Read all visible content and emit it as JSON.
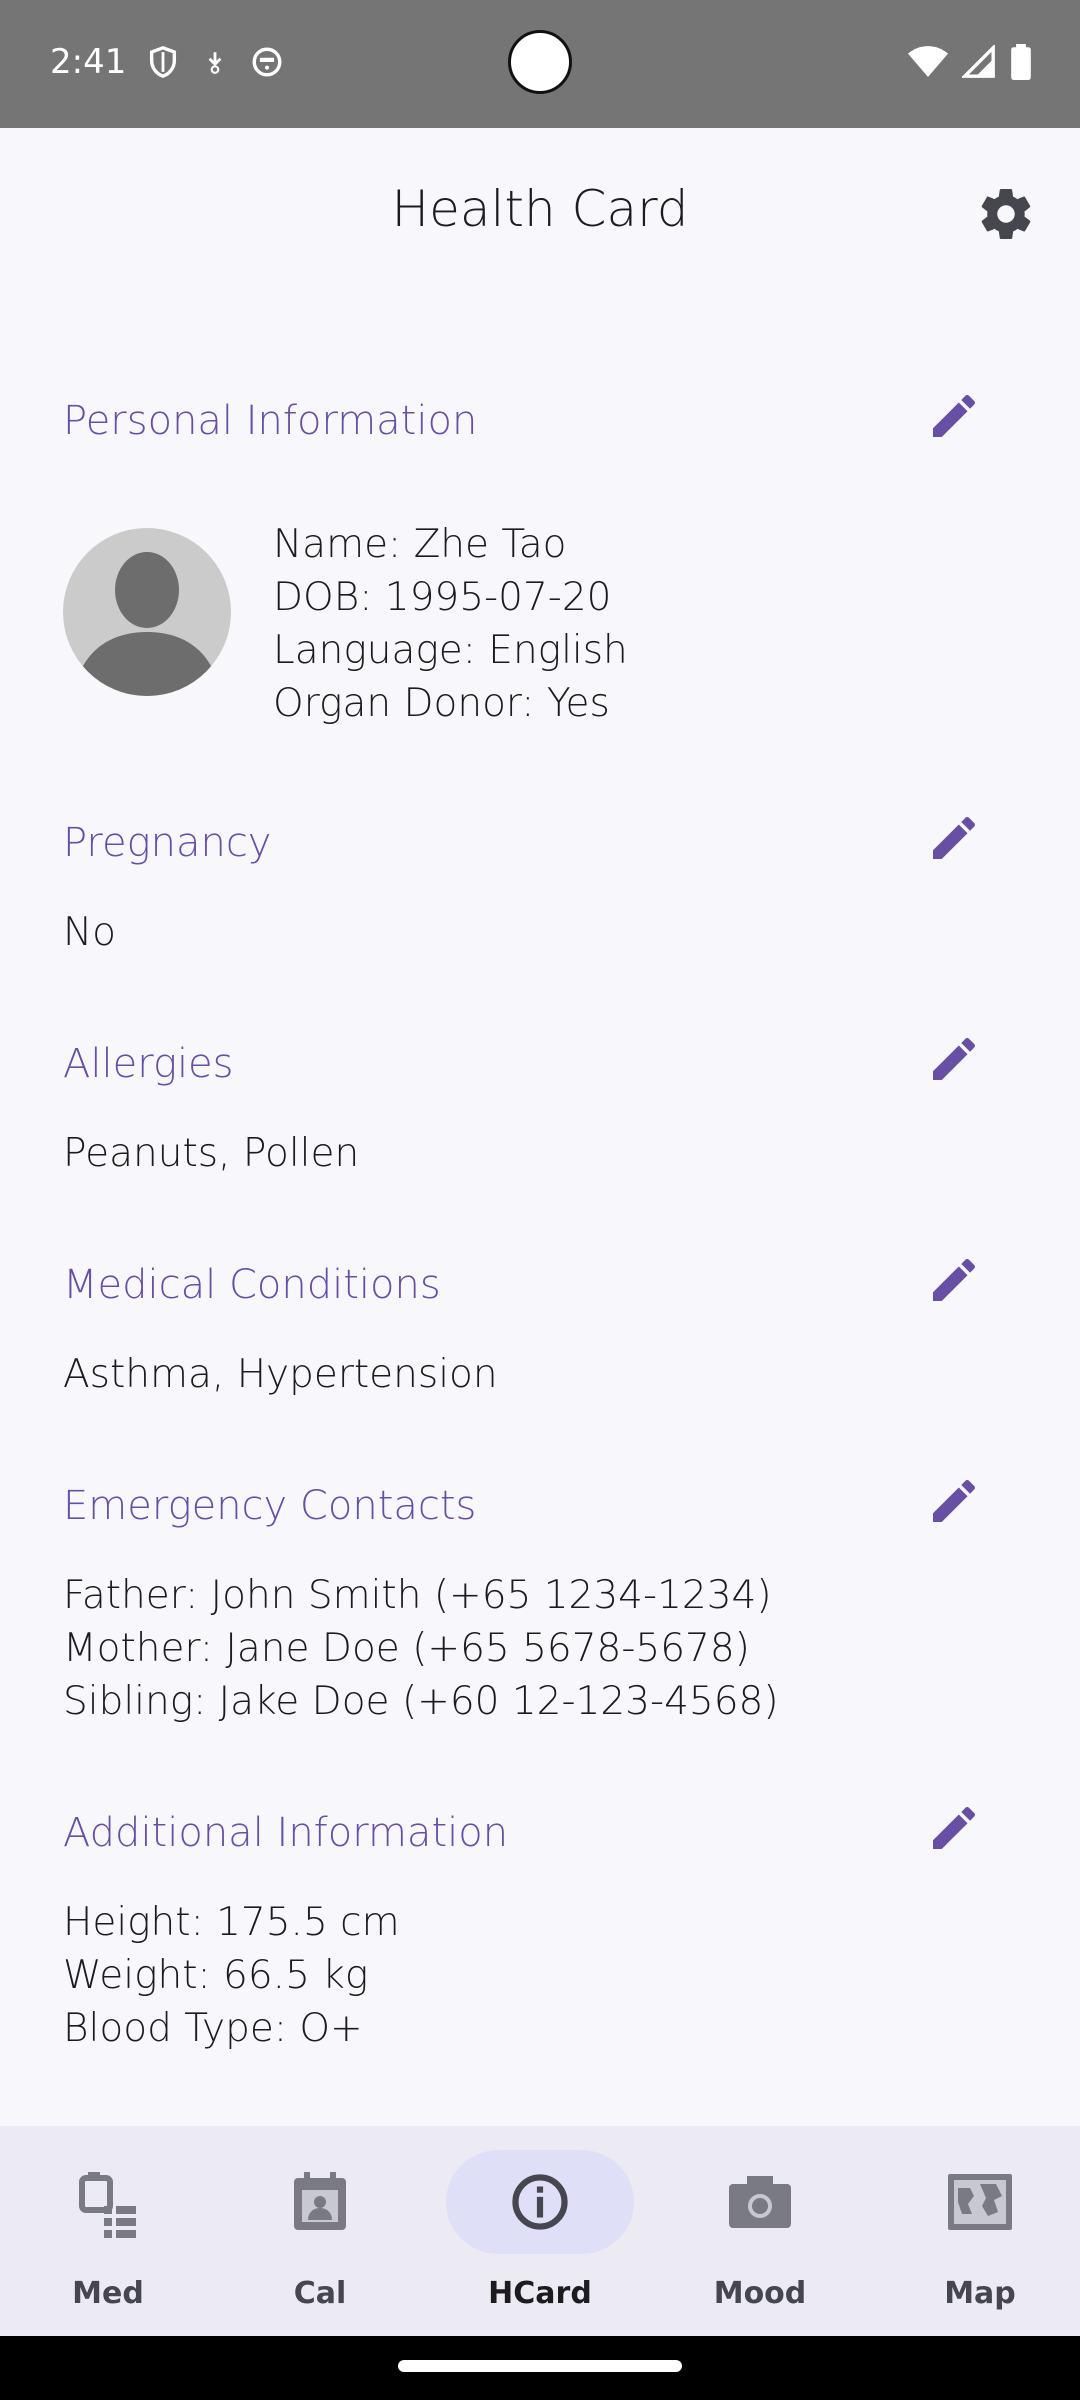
{
  "status_bar": {
    "time": "2:41",
    "left_icons": [
      "shield-icon",
      "download-arrow-icon",
      "face-icon"
    ],
    "right_icons": [
      "wifi-icon",
      "signal-icon",
      "battery-icon"
    ]
  },
  "header": {
    "title": "Health Card",
    "settings_icon": "gear-icon"
  },
  "sections": {
    "personal": {
      "title": "Personal Information",
      "name": "Name: Zhe Tao",
      "dob": "DOB: 1995-07-20",
      "language": "Language: English",
      "organ_donor": "Organ Donor: Yes"
    },
    "pregnancy": {
      "title": "Pregnancy",
      "value": "No"
    },
    "allergies": {
      "title": "Allergies",
      "value": "Peanuts, Pollen"
    },
    "conditions": {
      "title": "Medical Conditions",
      "value": "Asthma, Hypertension"
    },
    "contacts": {
      "title": "Emergency Contacts",
      "lines": [
        "Father: John Smith (+65 1234-1234)",
        "Mother: Jane Doe (+65 5678-5678)",
        "Sibling: Jake Doe (+60 12-123-4568)"
      ]
    },
    "additional": {
      "title": "Additional Information",
      "lines": [
        "Height: 175.5 cm",
        "Weight: 66.5 kg",
        "Blood Type: O+"
      ]
    }
  },
  "bottom_nav": {
    "items": [
      {
        "label": "Med",
        "icon": "medication-icon"
      },
      {
        "label": "Cal",
        "icon": "calendar-icon"
      },
      {
        "label": "HCard",
        "icon": "info-icon"
      },
      {
        "label": "Mood",
        "icon": "camera-icon"
      },
      {
        "label": "Map",
        "icon": "map-icon"
      }
    ],
    "active": "HCard"
  },
  "colors": {
    "accent": "#6750a4",
    "status_bar": "#757575",
    "background": "#f8f8fc",
    "nav_background": "#ecebf4",
    "nav_active_pill": "#dfe0f8"
  }
}
